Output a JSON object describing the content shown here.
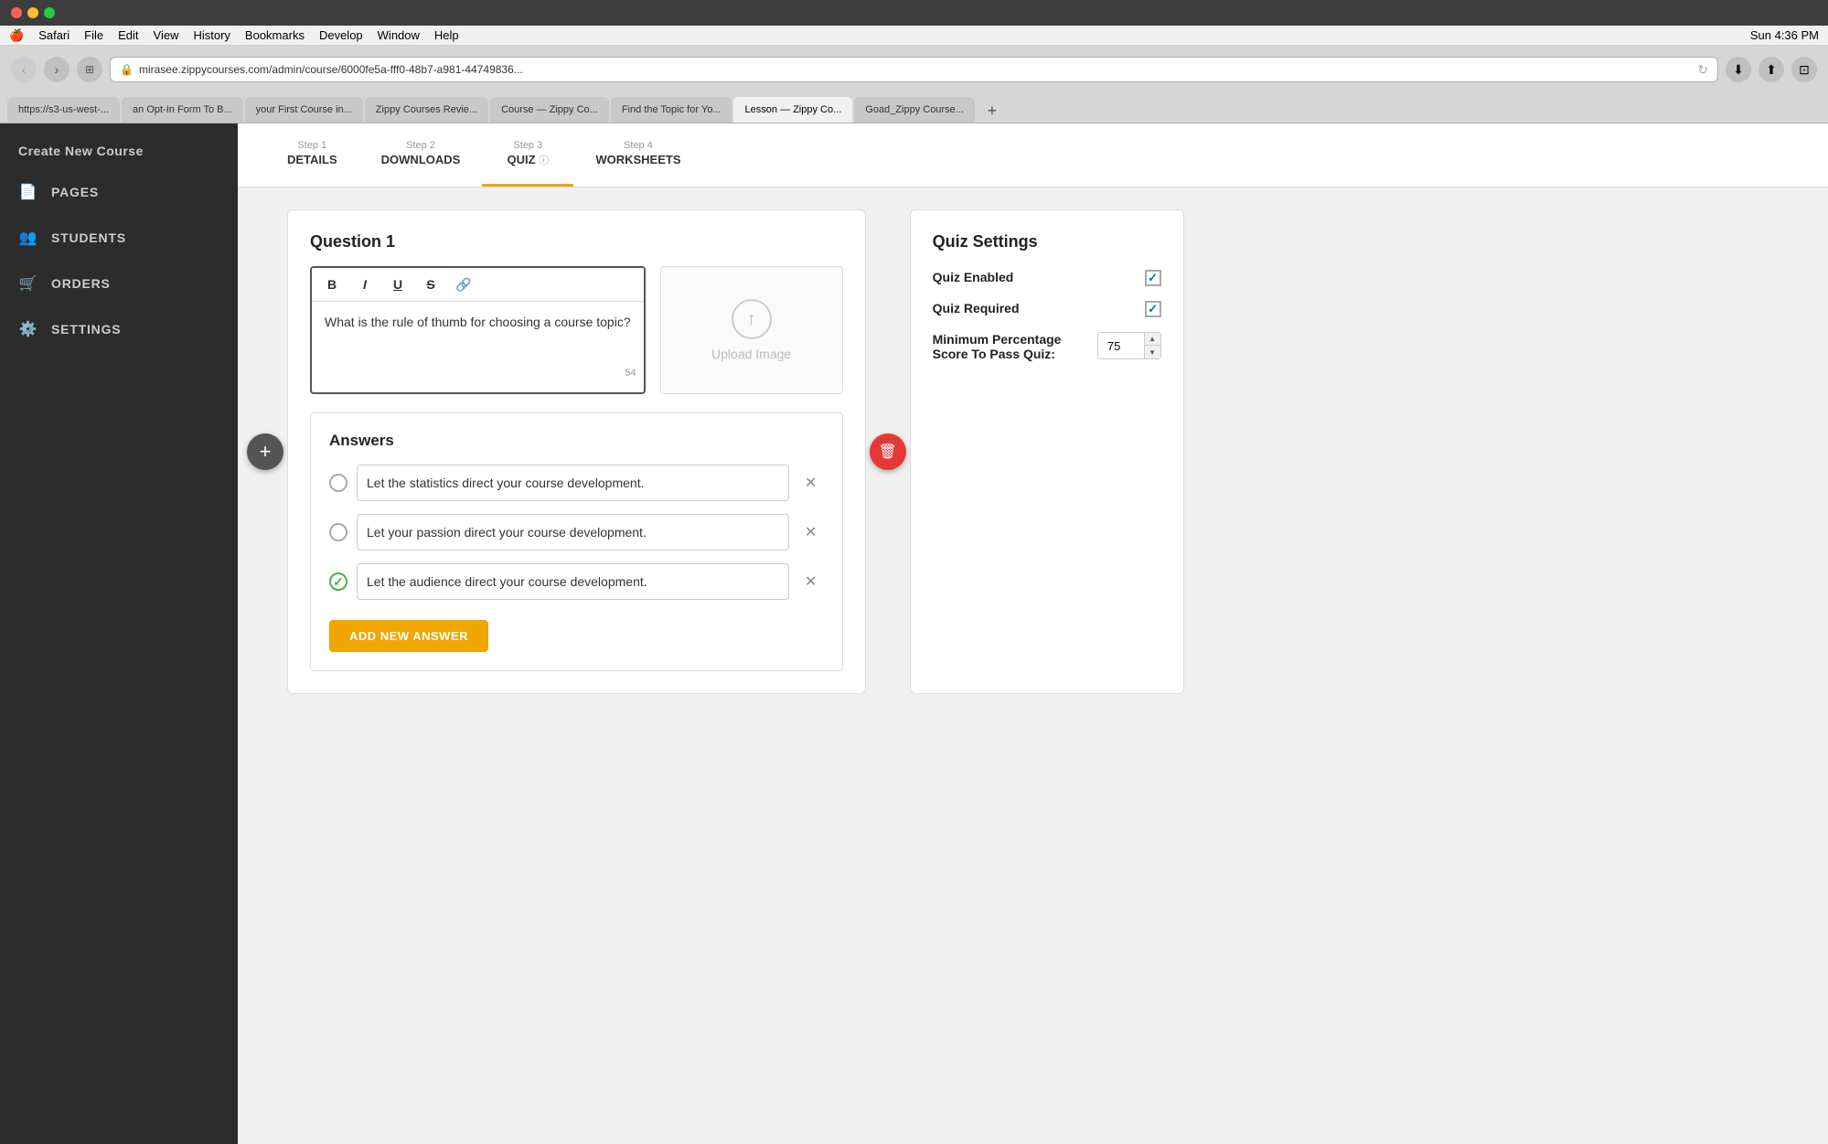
{
  "mac": {
    "menu_items": [
      "Apple",
      "Safari",
      "File",
      "Edit",
      "View",
      "History",
      "Bookmarks",
      "Develop",
      "Window",
      "Help"
    ],
    "time": "Sun 4:36 PM"
  },
  "browser": {
    "url": "mirasee.zippycourses.com/admin/course/6000fe5a-fff0-48b7-a981-44749836...",
    "tabs": [
      {
        "label": "https://s3-us-west-...",
        "active": false
      },
      {
        "label": "an Opt-In Form To B...",
        "active": false
      },
      {
        "label": "your First Course in...",
        "active": false
      },
      {
        "label": "Zippy Courses Revie...",
        "active": false
      },
      {
        "label": "Course — Zippy Co...",
        "active": false
      },
      {
        "label": "Find the Topic for Yo...",
        "active": false
      },
      {
        "label": "Lesson — Zippy Co...",
        "active": true
      },
      {
        "label": "Goad_Zippy Course...",
        "active": false
      }
    ]
  },
  "sidebar": {
    "header": "Create New Course",
    "items": [
      {
        "label": "PAGES",
        "icon": "📄"
      },
      {
        "label": "STUDENTS",
        "icon": "👥"
      },
      {
        "label": "ORDERS",
        "icon": "🛒"
      },
      {
        "label": "SETTINGS",
        "icon": "⚙️"
      }
    ]
  },
  "steps": [
    {
      "num": "Step 1",
      "name": "DETAILS",
      "active": false
    },
    {
      "num": "Step 2",
      "name": "DOWNLOADS",
      "active": false
    },
    {
      "num": "Step 3",
      "name": "QUIZ",
      "active": true,
      "has_icon": true
    },
    {
      "num": "Step 4",
      "name": "WORKSHEETS",
      "active": false
    }
  ],
  "question": {
    "title": "Question 1",
    "body_text": "What is the rule of thumb for choosing a course topic?",
    "char_count": "54",
    "upload_label": "Upload Image",
    "toolbar": {
      "bold": "B",
      "italic": "I",
      "underline": "U",
      "strikethrough": "S",
      "link": "🔗"
    }
  },
  "answers": {
    "title": "Answers",
    "items": [
      {
        "text": "Let the statistics direct your course development.",
        "checked": false
      },
      {
        "text": "Let your passion direct your course development.",
        "checked": false
      },
      {
        "text": "Let the audience direct your course development.",
        "checked": true
      }
    ],
    "add_btn_label": "ADD NEW ANSWER"
  },
  "quiz_settings": {
    "title": "Quiz Settings",
    "fields": [
      {
        "label": "Quiz Enabled",
        "type": "checkbox",
        "checked": true
      },
      {
        "label": "Quiz Required",
        "type": "checkbox",
        "checked": true
      },
      {
        "label": "Minimum Percentage Score To Pass Quiz:",
        "type": "number",
        "value": "75"
      }
    ]
  }
}
